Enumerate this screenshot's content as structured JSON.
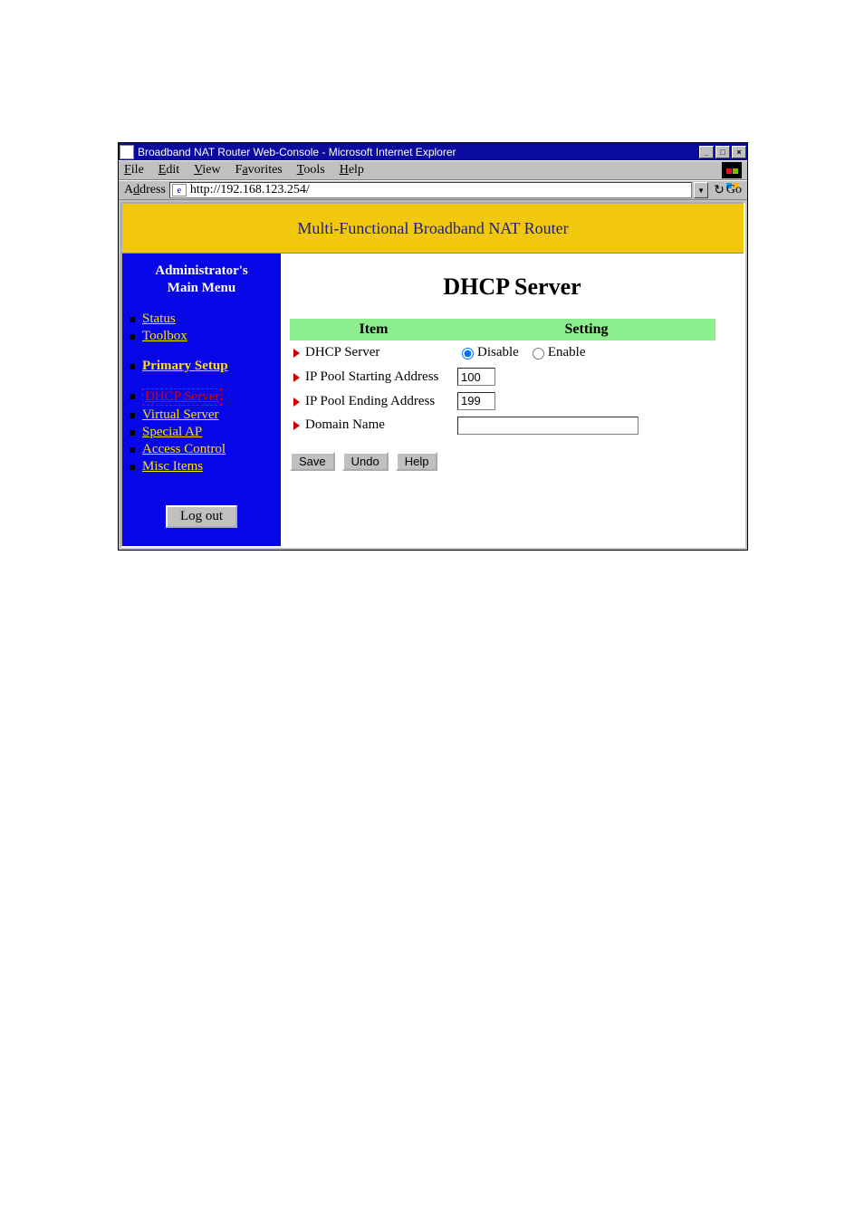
{
  "window": {
    "title": "Broadband NAT Router Web-Console - Microsoft Internet Explorer"
  },
  "menubar": {
    "file": "File",
    "edit": "Edit",
    "view": "View",
    "favorites": "Favorites",
    "tools": "Tools",
    "help": "Help"
  },
  "addressbar": {
    "label": "Address",
    "url": "http://192.168.123.254/",
    "go": "Go"
  },
  "banner": "Multi-Functional Broadband NAT Router",
  "sidebar": {
    "title_line1": "Administrator's",
    "title_line2": "Main Menu",
    "items": {
      "status": "Status",
      "toolbox": "Toolbox",
      "primary_setup": "Primary Setup",
      "dhcp_server": "DHCP Server",
      "virtual_server": "Virtual Server",
      "special_ap": "Special AP",
      "access_control": "Access Control",
      "misc_items": "Misc Items"
    },
    "logout": "Log out"
  },
  "main": {
    "title": "DHCP Server",
    "headers": {
      "item": "Item",
      "setting": "Setting"
    },
    "rows": {
      "dhcp_server": "DHCP Server",
      "ip_start": "IP Pool Starting Address",
      "ip_end": "IP Pool Ending Address",
      "domain": "Domain Name"
    },
    "radio": {
      "disable": "Disable",
      "enable": "Enable",
      "selected": "disable"
    },
    "values": {
      "ip_start": "100",
      "ip_end": "199",
      "domain": ""
    },
    "buttons": {
      "save": "Save",
      "undo": "Undo",
      "help": "Help"
    }
  }
}
